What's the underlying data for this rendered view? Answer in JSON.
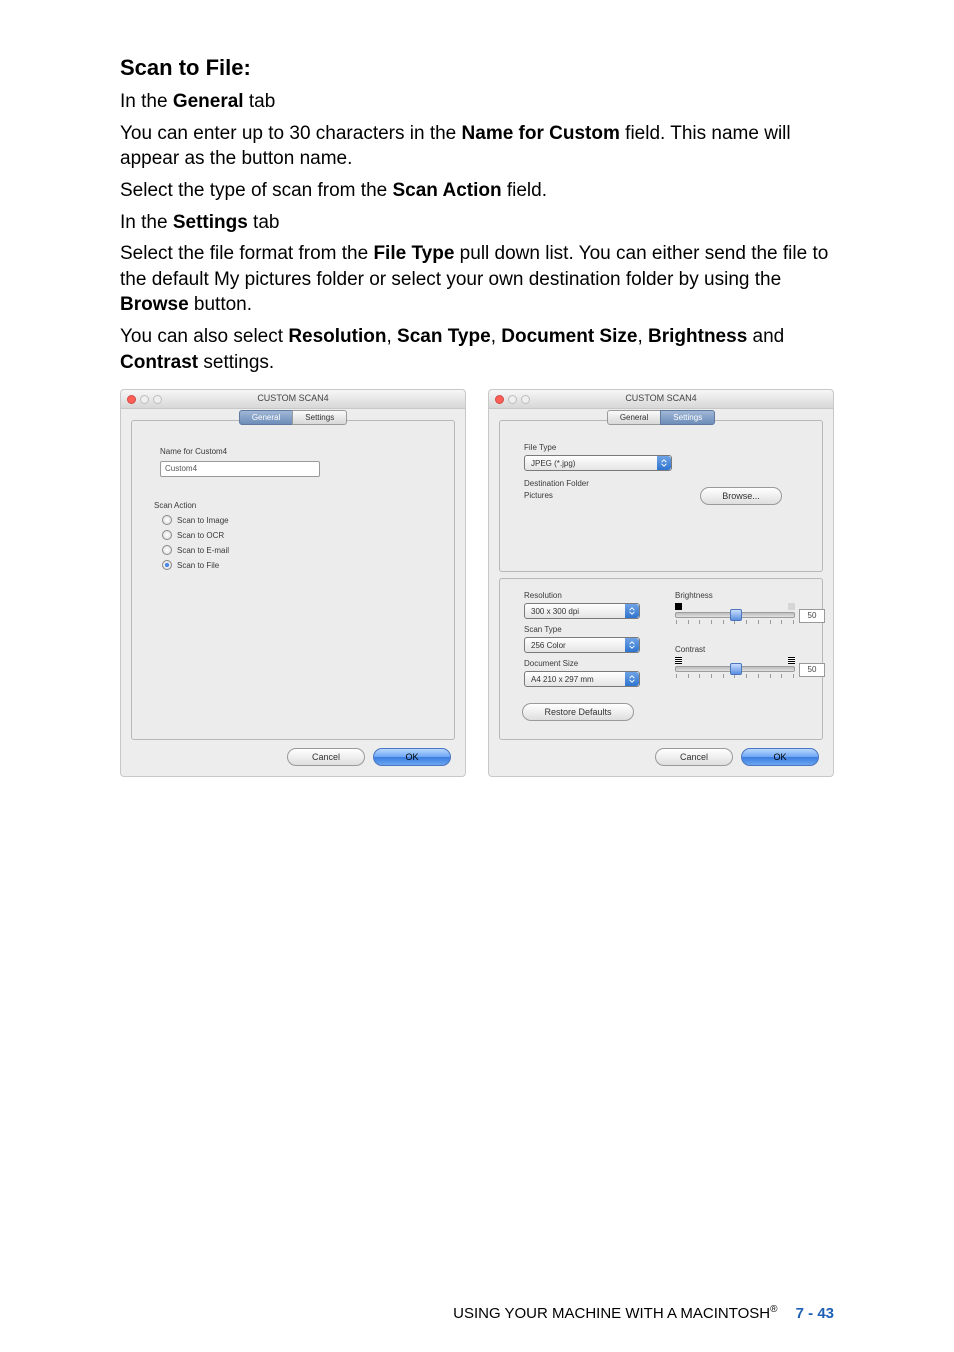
{
  "doc": {
    "heading": "Scan to File:",
    "p1_prefix": "In the ",
    "p1_bold": "General",
    "p1_suffix": " tab",
    "p2a": "You can enter up to 30 characters in the ",
    "p2b": "Name for Custom",
    "p2c": " field. This name will appear as the button name.",
    "p3a": "Select the type of scan from the ",
    "p3b": "Scan Action",
    "p3c": " field.",
    "p4_prefix": "In the ",
    "p4_bold": "Settings",
    "p4_suffix": " tab",
    "p5a": "Select the file format from the ",
    "p5b": "File Type",
    "p5c": " pull down list. You can either send the file to the default My pictures folder or select your own destination folder by using the ",
    "p5d": "Browse",
    "p5e": " button.",
    "p6a": "You can also select ",
    "p6b": "Resolution",
    "p6c": ", ",
    "p6d": "Scan Type",
    "p6e": ", ",
    "p6f": "Document Size",
    "p6g": ", ",
    "p6h": "Brightness",
    "p6i": " and ",
    "p6j": "Contrast",
    "p6k": " settings."
  },
  "win_general": {
    "title": "CUSTOM SCAN4",
    "tab_general": "General",
    "tab_settings": "Settings",
    "name_label": "Name for Custom4",
    "name_value": "Custom4",
    "scan_action_label": "Scan Action",
    "radio_image": "Scan to Image",
    "radio_ocr": "Scan to OCR",
    "radio_email": "Scan to E-mail",
    "radio_file": "Scan to File",
    "cancel": "Cancel",
    "ok": "OK"
  },
  "win_settings": {
    "title": "CUSTOM SCAN4",
    "tab_general": "General",
    "tab_settings": "Settings",
    "file_type_label": "File Type",
    "file_type_value": "JPEG (*.jpg)",
    "dest_folder_label": "Destination Folder",
    "dest_folder_value": "Pictures",
    "browse": "Browse...",
    "resolution_label": "Resolution",
    "resolution_value": "300 x 300 dpi",
    "scan_type_label": "Scan Type",
    "scan_type_value": "256 Color",
    "doc_size_label": "Document Size",
    "doc_size_value": "A4 210 x 297 mm",
    "brightness_label": "Brightness",
    "brightness_value": "50",
    "contrast_label": "Contrast",
    "contrast_value": "50",
    "restore": "Restore Defaults",
    "cancel": "Cancel",
    "ok": "OK"
  },
  "footer": {
    "text": "USING YOUR MACHINE WITH A MACINTOSH",
    "reg": "®",
    "page": "7 - 43"
  }
}
